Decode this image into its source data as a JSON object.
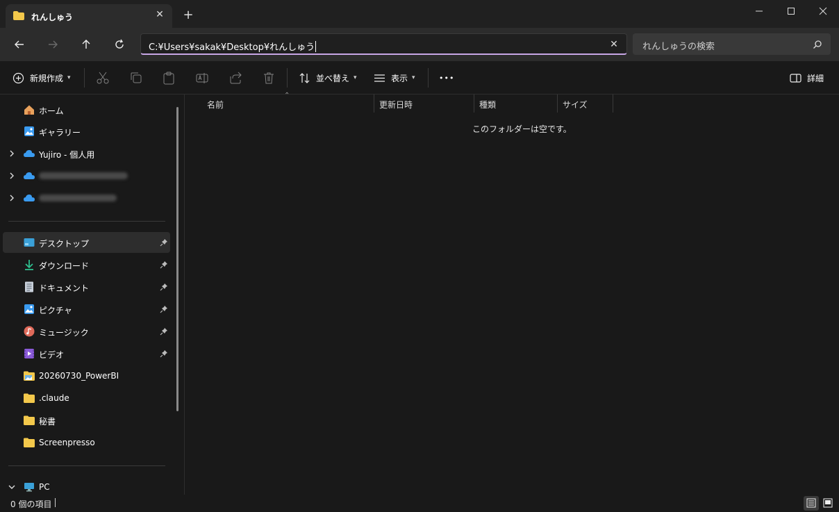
{
  "window": {
    "tab_title": "れんしゅう",
    "tab_close": "✕",
    "new_tab": "+"
  },
  "address_bar": {
    "path": "C:¥Users¥sakak¥Desktop¥れんしゅう",
    "clear": "✕",
    "search_placeholder": "れんしゅうの検索"
  },
  "toolbar": {
    "new_label": "新規作成",
    "sort_label": "並べ替え",
    "view_label": "表示",
    "more_label": "•••",
    "details_label": "詳細"
  },
  "sidebar": {
    "items": [
      {
        "label": "ホーム",
        "icon": "home-icon"
      },
      {
        "label": "ギャラリー",
        "icon": "gallery-icon"
      },
      {
        "label": "Yujiro - 個人用",
        "icon": "onedrive-icon"
      }
    ],
    "quick_access": [
      {
        "label": "デスクトップ",
        "icon": "desktop-icon",
        "pinned": true
      },
      {
        "label": "ダウンロード",
        "icon": "download-icon",
        "pinned": true
      },
      {
        "label": "ドキュメント",
        "icon": "document-icon",
        "pinned": true
      },
      {
        "label": "ピクチャ",
        "icon": "pictures-icon",
        "pinned": true
      },
      {
        "label": "ミュージック",
        "icon": "music-icon",
        "pinned": true
      },
      {
        "label": "ビデオ",
        "icon": "video-icon",
        "pinned": true
      },
      {
        "label": "20260730_PowerBI",
        "icon": "folder-icon",
        "pinned": false
      },
      {
        "label": ".claude",
        "icon": "folder-icon",
        "pinned": false
      },
      {
        "label": "秘書",
        "icon": "folder-icon",
        "pinned": false
      },
      {
        "label": "Screenpresso",
        "icon": "folder-icon",
        "pinned": false
      }
    ],
    "pc_label": "PC"
  },
  "columns": {
    "name": "名前",
    "modified": "更新日時",
    "type": "種類",
    "size": "サイズ"
  },
  "content": {
    "empty_message": "このフォルダーは空です。"
  },
  "status": {
    "item_count": "0 個の項目"
  },
  "colors": {
    "accent_underline": "#c8a6e6",
    "folder_yellow": "#f3c84b",
    "onedrive_blue": "#3a9bf0"
  }
}
